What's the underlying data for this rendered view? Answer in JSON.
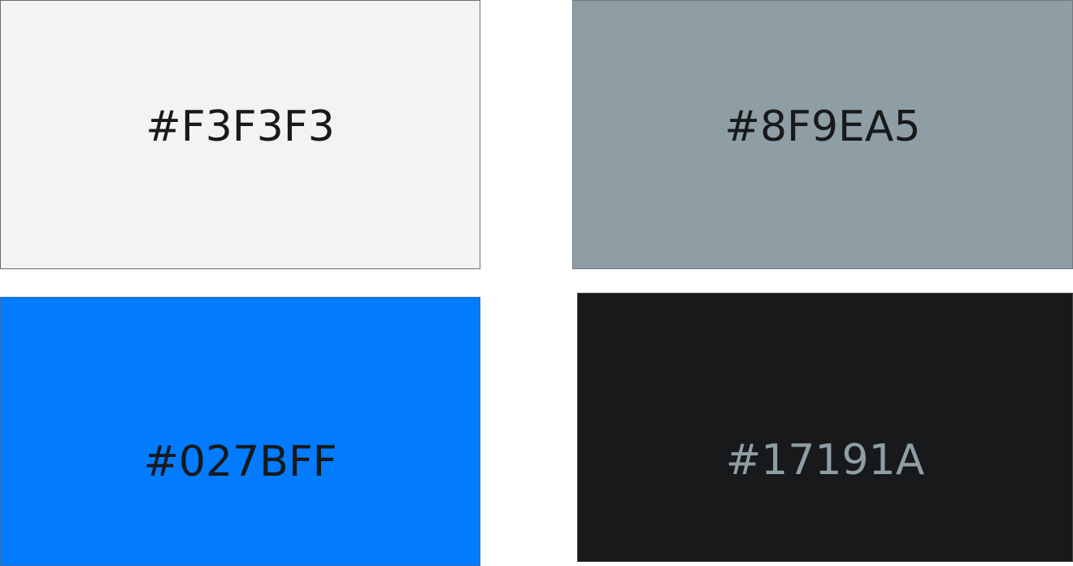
{
  "swatches": [
    {
      "label": "#F3F3F3",
      "color": "#F3F3F3",
      "text_color": "#17191A"
    },
    {
      "label": "#8F9EA5",
      "color": "#8F9EA5",
      "text_color": "#17191A"
    },
    {
      "label": "#027BFF",
      "color": "#027BFF",
      "text_color": "#17191A"
    },
    {
      "label": "#17191A",
      "color": "#17191A",
      "text_color": "#8F9EA5"
    }
  ]
}
